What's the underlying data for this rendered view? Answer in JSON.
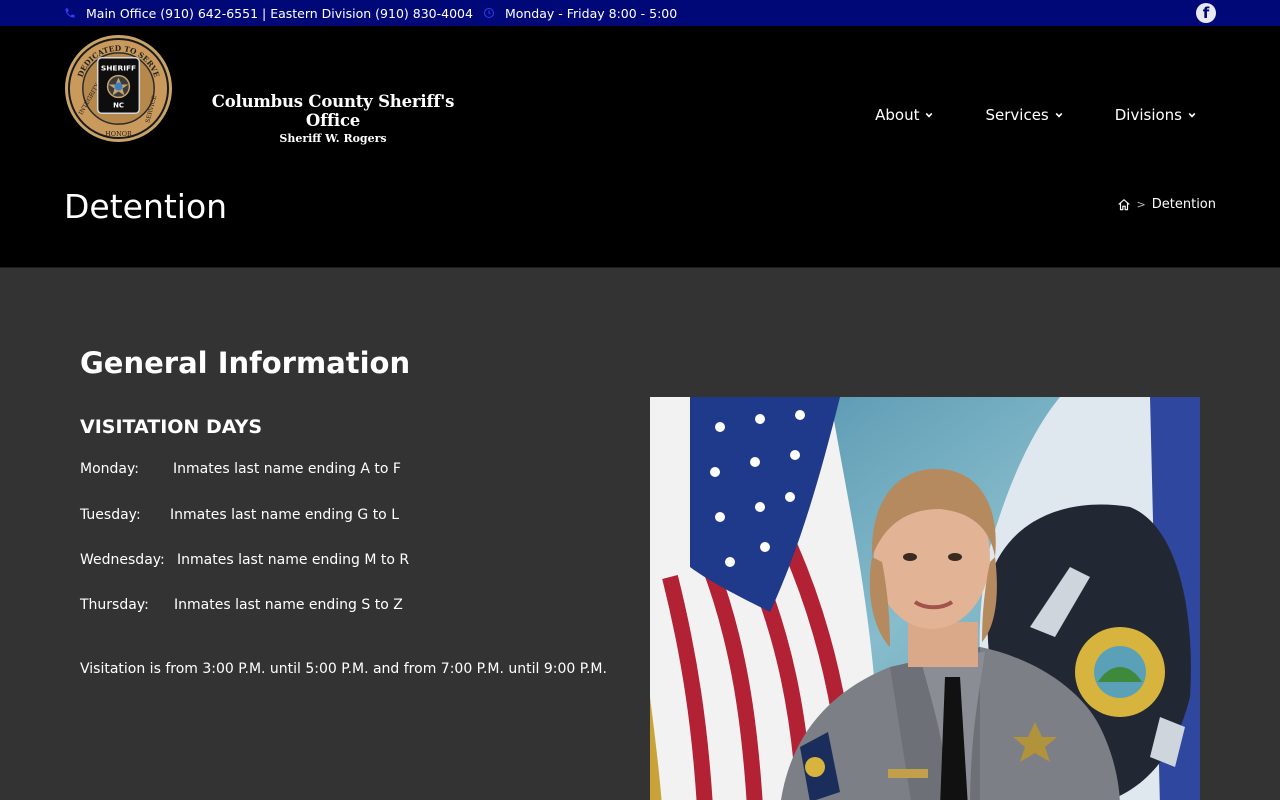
{
  "topbar": {
    "phone_text": "Main Office (910) 642-6551 | Eastern Division (910) 830-4004",
    "hours_text": "Monday - Friday 8:00 - 5:00",
    "phone_icon": "phone-icon",
    "clock_icon": "clock-icon",
    "facebook_icon": "facebook-icon"
  },
  "header": {
    "brand_name": "Columbus County Sheriff's Office",
    "brand_sub": "Sheriff W. Rogers",
    "logo": {
      "top_text": "DEDICATED TO SERVE",
      "left_text": "INTEGRITY",
      "bottom_text": "HONOR",
      "right_text": "SERVICE",
      "badge_title": "SHERIFF",
      "badge_state": "NC"
    }
  },
  "nav": {
    "items": [
      {
        "label": "About"
      },
      {
        "label": "Services"
      },
      {
        "label": "Divisions"
      }
    ]
  },
  "page": {
    "title": "Detention",
    "breadcrumb_current": "Detention",
    "breadcrumb_separator": ">"
  },
  "content": {
    "heading": "General Information",
    "subheading": "VISITATION DAYS",
    "schedule": [
      {
        "day": "Monday:",
        "text": "Inmates last name ending A to F"
      },
      {
        "day": "Tuesday:",
        "text": "Inmates last name ending G to L"
      },
      {
        "day": "Wednesday:",
        "text": "Inmates last name ending M to R"
      },
      {
        "day": "Thursday:",
        "text": "Inmates last name ending S to Z"
      }
    ],
    "visitation_hours": "Visitation is from 3:00 P.M. until 5:00 P.M. and from 7:00 P.M. until 9:00 P.M."
  },
  "colors": {
    "topbar_bg": "#000877",
    "header_bg": "#000000",
    "content_bg": "#333333",
    "accent": "#2f3ff5"
  }
}
